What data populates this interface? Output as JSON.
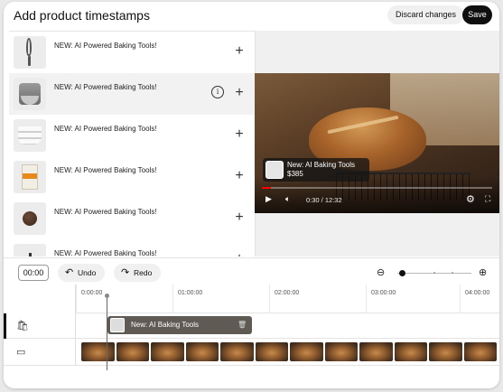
{
  "header": {
    "title": "Add product timestamps",
    "discard_label": "Discard changes",
    "save_label": "Save"
  },
  "products": [
    {
      "label": "NEW: AI Powered Baking Tools!",
      "icon": "whisk-icon",
      "editing": true
    },
    {
      "label": "NEW: AI Powered Baking Tools!",
      "icon": "stand-mixer-icon",
      "highlighted": true
    },
    {
      "label": "NEW: AI Powered Baking Tools!",
      "icon": "bowls-icon"
    },
    {
      "label": "NEW: AI Powered Baking Tools!",
      "icon": "flour-bag-icon"
    },
    {
      "label": "NEW: AI Powered Baking Tools!",
      "icon": "spice-ball-icon"
    },
    {
      "label": "NEW: AI Powered Baking Tools!",
      "icon": "utensil-icon"
    }
  ],
  "list_actions": {
    "add_glyph": "+",
    "info_glyph": "i"
  },
  "video": {
    "overlay_name": "New: AI Baking Tools",
    "overlay_price": "$385",
    "time": "0:30 / 12:32",
    "progress": 0.04,
    "progress_color": "#ff0000"
  },
  "toolbar": {
    "timecode": "00:00",
    "undo_label": "Undo",
    "redo_label": "Redo",
    "zoom_level": 0.06
  },
  "timeline": {
    "ticks": [
      "0:00:00",
      "01:00:00",
      "02:00:00",
      "03:00:00",
      "04:00:00"
    ],
    "segment_label": "New: AI Baking Tools",
    "frame_count": 12
  },
  "colors": {
    "accent": "#0f0f0f",
    "progress": "#ff0000"
  }
}
